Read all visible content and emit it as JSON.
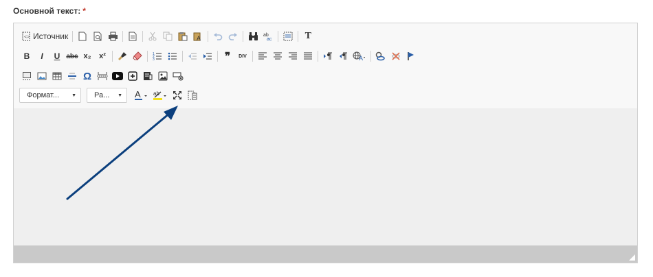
{
  "field": {
    "label": "Основной текст:",
    "required_mark": "*"
  },
  "toolbar": {
    "source_label": "Источник",
    "format_combo": "Формат...",
    "size_combo": "Ра...",
    "bold": "B",
    "italic": "I",
    "underline": "U",
    "strike": "abc",
    "subscript": "x₂",
    "superscript": "x²",
    "quote": "❞",
    "div": "DIV",
    "special_char": "Ω",
    "text_T": "T"
  },
  "colors": {
    "accent": "#0b3f7d",
    "editor_bg": "#efefef",
    "bottombar": "#c9c9c9"
  }
}
